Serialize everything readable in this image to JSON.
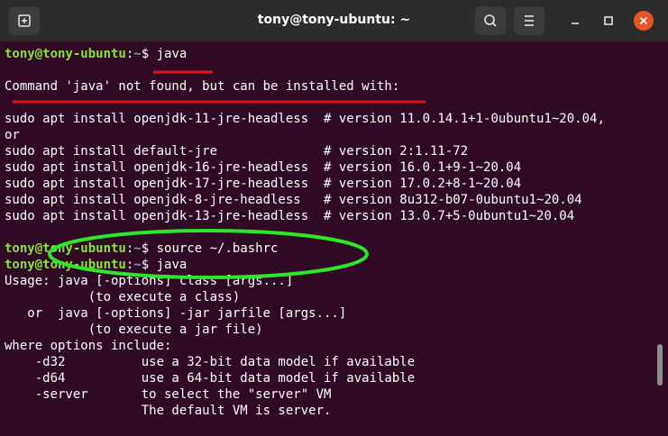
{
  "window": {
    "title": "tony@tony-ubuntu: ~",
    "icons": [
      "new-tab-icon",
      "search-icon",
      "hamburger-menu-icon",
      "minimize-icon",
      "maximize-icon",
      "close-icon"
    ],
    "colors": {
      "titlebar": "#2c2c2c",
      "terminal_bg": "#300a24",
      "prompt_user": "#8ae234",
      "prompt_path": "#729fcf",
      "close": "#e95420",
      "red_annotation": "#e0141e",
      "green_annotation": "#2ce62c"
    }
  },
  "terminal": {
    "prompt": {
      "user": "tony@tony-ubuntu",
      "sep": ":",
      "path": "~",
      "sign": "$"
    },
    "cmd1": " java",
    "lines1": [
      "Command 'java' not found, but can be installed with:",
      "",
      "sudo apt install openjdk-11-jre-headless  # version 11.0.14.1+1-0ubuntu1~20.04,",
      "or",
      "sudo apt install default-jre              # version 2:1.11-72",
      "sudo apt install openjdk-16-jre-headless  # version 16.0.1+9-1~20.04",
      "sudo apt install openjdk-17-jre-headless  # version 17.0.2+8-1~20.04",
      "sudo apt install openjdk-8-jre-headless   # version 8u312-b07-0ubuntu1~20.04",
      "sudo apt install openjdk-13-jre-headless  # version 13.0.7+5-0ubuntu1~20.04",
      ""
    ],
    "cmd2": " source ~/.bashrc",
    "cmd3": " java",
    "lines2": [
      "Usage: java [-options] class [args...]",
      "           (to execute a class)",
      "   or  java [-options] -jar jarfile [args...]",
      "           (to execute a jar file)",
      "where options include:",
      "    -d32          use a 32-bit data model if available",
      "    -d64          use a 64-bit data model if available",
      "    -server       to select the \"server\" VM",
      "                  The default VM is server."
    ]
  }
}
